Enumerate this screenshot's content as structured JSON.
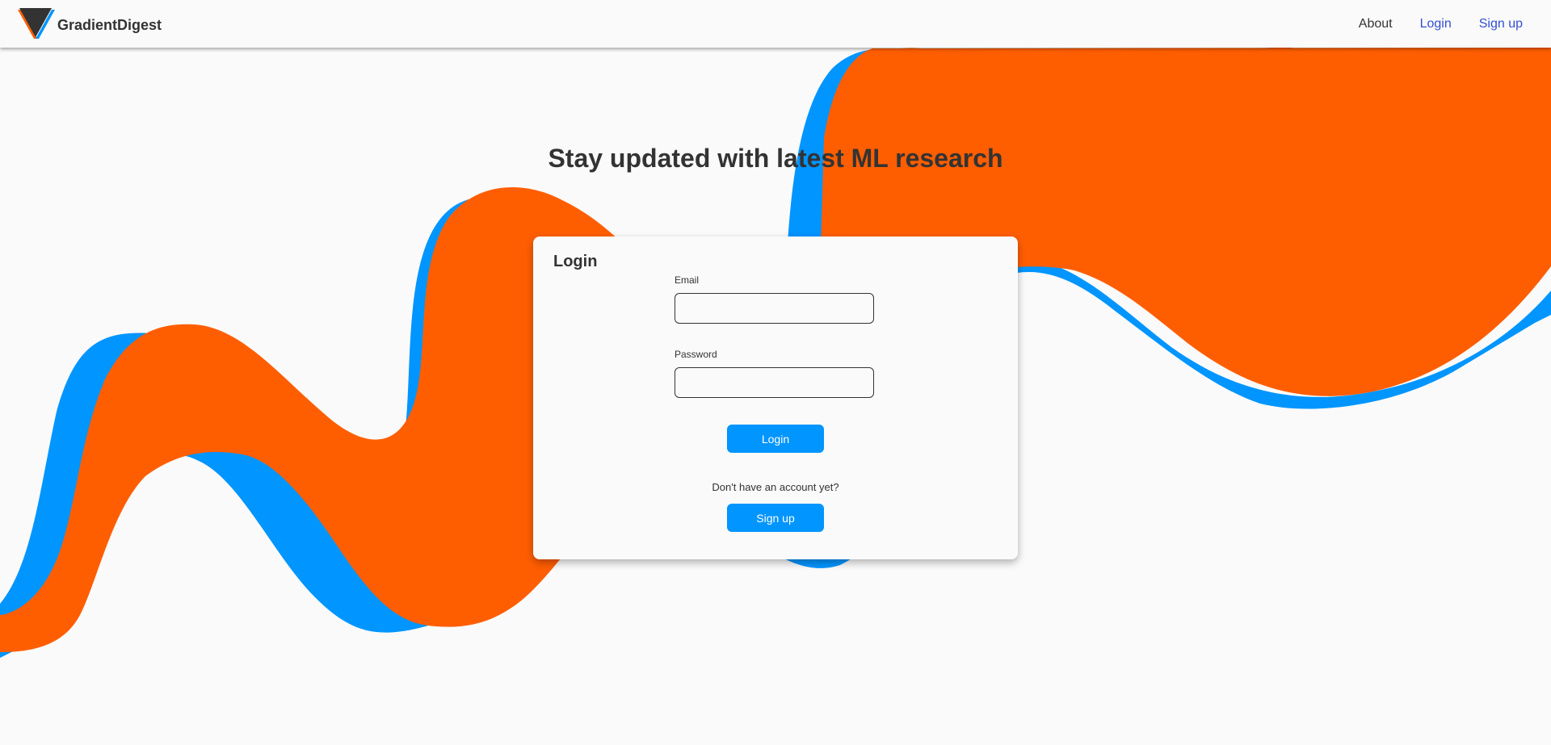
{
  "header": {
    "brand_name": "GradientDigest",
    "nav": {
      "about": "About",
      "login": "Login",
      "signup": "Sign up"
    }
  },
  "hero": {
    "headline": "Stay updated with latest ML research"
  },
  "login_card": {
    "title": "Login",
    "email_label": "Email",
    "email_value": "",
    "password_label": "Password",
    "password_value": "",
    "login_button": "Login",
    "signup_prompt": "Don't have an account yet?",
    "signup_button": "Sign up"
  },
  "colors": {
    "accent_orange": "#ff5e00",
    "accent_blue": "#0095ff",
    "link_blue": "#3350d0",
    "text": "#333333",
    "background": "#fafafa"
  },
  "icons": {
    "logo": "triangle-logo-icon"
  }
}
